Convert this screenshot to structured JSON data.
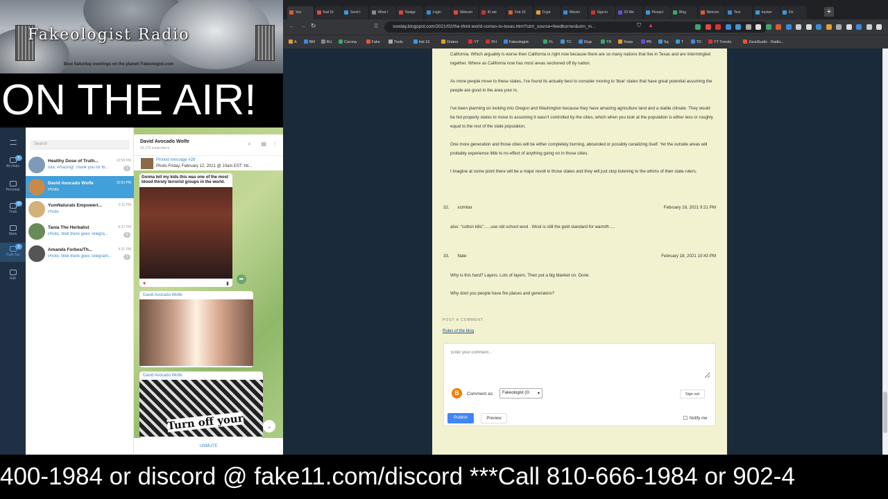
{
  "banner": {
    "title": "Fakeologist Radio",
    "subtitle": "Best Saturday evenings on the planet! Fakeologist.com"
  },
  "onair": "ON THE AIR!",
  "telegram": {
    "rail": [
      {
        "label": "All chats",
        "badge": "6"
      },
      {
        "label": "Personal",
        "badge": ""
      },
      {
        "label": "Truth",
        "badge": "33"
      },
      {
        "label": "Work",
        "badge": ""
      },
      {
        "label": "Truth Top",
        "badge": "3"
      },
      {
        "label": "Edit",
        "badge": ""
      }
    ],
    "search_placeholder": "Search",
    "chats": [
      {
        "name": "Healthy Dose of Truth...",
        "preview": "Iola: Amazing! Thank you for th...",
        "time": "10:58 PM",
        "badge": "1",
        "color": "#7d9bb8"
      },
      {
        "name": "David Avocado Wolfe",
        "preview": "Photo",
        "time": "10:50 PM",
        "badge": "",
        "color": "#c88a4a"
      },
      {
        "name": "YumNaturals Empoweri...",
        "preview": "Photo",
        "time": "9:11 PM",
        "badge": "",
        "color": "#d4b07a"
      },
      {
        "name": "Tania The Herbalist",
        "preview": "Photo, Well there goes Telegra...",
        "time": "6:37 PM",
        "badge": "8",
        "color": "#6a8a5a"
      },
      {
        "name": "Amanda Forbes/Th...",
        "preview": "Photo, Well there goes Telegram...",
        "time": "4:31 PM",
        "badge": "1",
        "color": "#555"
      }
    ],
    "channel": {
      "title": "David Avocado Wolfe",
      "subscribers": "43,175 subscribers"
    },
    "pinned": {
      "label": "Pinned message #28",
      "text": "Photo Friday, February 12, 2021 @ 10am EST: htt..."
    },
    "msg1_caption": "Gonna tell my kids this was one of the most blood thirsty terrorist groups in the world.",
    "msg2_from": "David Avocado Wolfe",
    "msg3_from": "David Avocado Wolfe",
    "msg3_overlay": "Turn off your",
    "unmute": "UNMUTE"
  },
  "browser": {
    "tabs": [
      "Vox",
      "Karl Dr",
      "Send t",
      "What t",
      "Nudge",
      "Login",
      "Welcom",
      "ID ete",
      "Feb 15",
      "Crypt",
      "Bitcoin",
      "Sign-in",
      "ID We",
      "Pinnacl",
      "Blog",
      "Welcom",
      "Test",
      "tracker",
      "Do"
    ],
    "url": "voxday.blogspot.com/2021/02/the-third-world-comes-to-texas.html?utm_source=feedburner&utm_m...",
    "bookmarks": [
      "A",
      "BM",
      "BU",
      "Corona",
      "Fake",
      "Tools",
      "feb 15",
      "Orders",
      "YT",
      "PH",
      "Fakeologist",
      "FL",
      "TC",
      "ISup",
      "TR",
      "Keep",
      "PB",
      "Sq",
      "T",
      "TD",
      "YT Trends",
      "ZaraStudio - Radio..."
    ]
  },
  "post": {
    "paragraphs": [
      "California. Which arguably is worse then California is right now because there are so many nations that live in Texas and are intermingled together. Where as California now has most areas sectioned off by nation.",
      "As more people move to these states, I've found its actually best to consider moving to 'blue' states that have great potential assuming the people are good in the area your in.",
      "I've been planning on looking into Oregon and Washington because they have amazing agriculture land and a stable climate. They would be hot property states to move to assuming it wasn't controlled by the cities, which when you look at the population is either less or roughly equal to the rest of the state population.",
      "One more generation and those cities will be either completely burning, abounded or possibly canalizing itself. Yet the outside areas will probably experience little to no effect of anything going on in those cities.",
      "I imagine at some point there will be a major revolt in those states and they will just stop listening to the whims of their state rulers."
    ],
    "comments": [
      {
        "num": "32.",
        "author": "scimitar",
        "date": "February 18, 2021 9:21 PM",
        "lines": [
          "also: \"cotton kills\"......use old school wool . Wool is still the gold standard for warmth ...."
        ]
      },
      {
        "num": "33.",
        "author": "Nate",
        "date": "February 18, 2021 10:43 PM",
        "lines": [
          "Why is this hard? Layers. Lots of layers. Then put a big blanket on. Done.",
          "Why dont you people have fire places and generators?"
        ]
      }
    ],
    "post_a_comment": "POST A COMMENT",
    "rules": "Rules of the blog",
    "placeholder": "Enter your comment...",
    "comment_as": "Comment as:",
    "identity": "Fakeologist (G",
    "sign_out": "Sign out",
    "publish": "Publish",
    "preview": "Preview",
    "notify": "Notify me"
  },
  "ticker": "400-1984 or discord @ fake11.com/discord ***Call 810-666-1984 or 902-4"
}
